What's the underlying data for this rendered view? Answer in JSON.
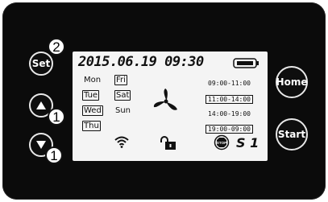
{
  "buttons": {
    "set": "Set",
    "home": "Home",
    "start": "Start"
  },
  "badges": {
    "set": "2",
    "up": "1",
    "down": "1"
  },
  "display": {
    "datetime": "2015.06.19 09:30",
    "days": [
      {
        "label": "Mon",
        "boxed": false
      },
      {
        "label": "Fri",
        "boxed": true
      },
      {
        "label": "Tue",
        "boxed": true
      },
      {
        "label": "Sat",
        "boxed": true
      },
      {
        "label": "Wed",
        "boxed": true
      },
      {
        "label": "Sun",
        "boxed": false
      },
      {
        "label": "Thu",
        "boxed": true
      }
    ],
    "time_slots": [
      {
        "label": "09:00-11:00",
        "boxed": false
      },
      {
        "label": "11:00-14:00",
        "boxed": true
      },
      {
        "label": "14:00-19:00",
        "boxed": false
      },
      {
        "label": "19:00-09:00",
        "boxed": true
      }
    ],
    "stop_label": "STOP",
    "speed": "S 1",
    "icons": [
      "battery-icon",
      "fan-icon",
      "wifi-icon",
      "unlock-icon",
      "stop-icon"
    ]
  }
}
